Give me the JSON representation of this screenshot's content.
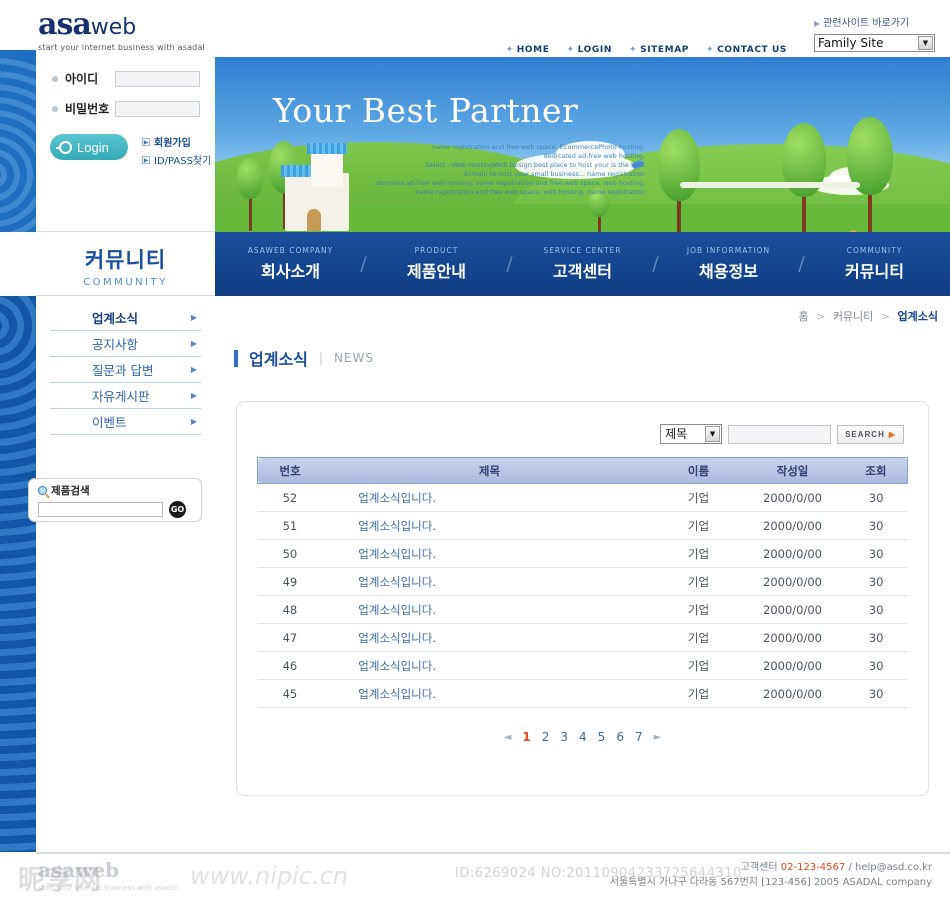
{
  "header": {
    "logo_main": "asa",
    "logo_sub": "web",
    "tagline": "start your internet business with asadal",
    "topnav": [
      {
        "label": "HOME"
      },
      {
        "label": "LOGIN"
      },
      {
        "label": "SITEMAP"
      },
      {
        "label": "CONTACT US"
      }
    ],
    "family": {
      "label": "관련사이트 바로가기",
      "selected": "Family Site"
    }
  },
  "login": {
    "id_label": "아이디",
    "pw_label": "비밀번호",
    "id_value": "",
    "pw_value": "",
    "button": "Login",
    "join": "회원가입",
    "findpass": "ID/PASS찾기"
  },
  "section": {
    "title_ko": "커뮤니티",
    "title_en": "COMMUNITY"
  },
  "sidemenu": {
    "items": [
      {
        "label": "업계소식",
        "active": true
      },
      {
        "label": "공지사항",
        "active": false
      },
      {
        "label": "질문과 답변",
        "active": false
      },
      {
        "label": "자유게시판",
        "active": false
      },
      {
        "label": "이벤트",
        "active": false
      }
    ]
  },
  "product_search": {
    "title": "제품검색",
    "value": "",
    "go": "GO"
  },
  "banner": {
    "title": "Your Best Partner",
    "body_lines": [
      "name registration and free web space.  EcommercePhoto hosting.",
      "dedicated ad-free web hosting.",
      "Select --Web HostingWeb Design  best place to host your is the best",
      "domain to host your small business... name registration",
      "domains ad-free web hosting, name registration and free web space. web hosting,",
      "name registration and free web space. web hosting, name registration"
    ]
  },
  "mainnav": {
    "items": [
      {
        "en": "ASAWEB COMPANY",
        "ko": "회사소개"
      },
      {
        "en": "PRODUCT",
        "ko": "제품안내"
      },
      {
        "en": "SERVICE CENTER",
        "ko": "고객센터"
      },
      {
        "en": "JOB INFORMATION",
        "ko": "채용정보"
      },
      {
        "en": "COMMUNITY",
        "ko": "커뮤니티"
      }
    ],
    "separator": "/"
  },
  "breadcrumb": {
    "home": "홈",
    "parent": "커뮤니티",
    "current": "업계소식",
    "separator": ">"
  },
  "page_title": {
    "ko": "업계소식",
    "divider": "|",
    "en": "NEWS"
  },
  "search": {
    "select_value": "제목",
    "input_value": "",
    "button": "SEARCH"
  },
  "board": {
    "headers": [
      "번호",
      "제목",
      "이름",
      "작성일",
      "조회"
    ],
    "rows": [
      {
        "no": "52",
        "subject": "업계소식입니다.",
        "name": "기업",
        "date": "2000/0/00",
        "hits": "30"
      },
      {
        "no": "51",
        "subject": "업계소식입니다.",
        "name": "기업",
        "date": "2000/0/00",
        "hits": "30"
      },
      {
        "no": "50",
        "subject": "업계소식입니다.",
        "name": "기업",
        "date": "2000/0/00",
        "hits": "30"
      },
      {
        "no": "49",
        "subject": "업계소식입니다.",
        "name": "기업",
        "date": "2000/0/00",
        "hits": "30"
      },
      {
        "no": "48",
        "subject": "업계소식입니다.",
        "name": "기업",
        "date": "2000/0/00",
        "hits": "30"
      },
      {
        "no": "47",
        "subject": "업계소식입니다.",
        "name": "기업",
        "date": "2000/0/00",
        "hits": "30"
      },
      {
        "no": "46",
        "subject": "업계소식입니다.",
        "name": "기업",
        "date": "2000/0/00",
        "hits": "30"
      },
      {
        "no": "45",
        "subject": "업계소식입니다.",
        "name": "기업",
        "date": "2000/0/00",
        "hits": "30"
      }
    ]
  },
  "pagination": {
    "prev": "◄",
    "next": "►",
    "pages": [
      "1",
      "2",
      "3",
      "4",
      "5",
      "6",
      "7"
    ],
    "current": "1"
  },
  "footer": {
    "logo_main": "asa",
    "logo_sub": "web",
    "tagline": "start your internet business with asadal",
    "line1_label": "고객센터",
    "line1_phone": "02-123-4567",
    "line1_sep": "/",
    "line1_mail": "help@asd.co.kr",
    "line2": "서울특별시 가나구 다라동 567번지 [123-456] 2005 ASADAL company"
  },
  "watermark": {
    "cn": "昵享网",
    "url": "www.nipic.cn",
    "id_line": "ID:6269024   NO:20110904233725644310"
  },
  "colors": {
    "brand_navy": "#17306e",
    "nav_blue": "#0f3e84",
    "accent_orange": "#e4471a",
    "link_blue": "#2a65ac",
    "header_row": "#aab9de"
  }
}
